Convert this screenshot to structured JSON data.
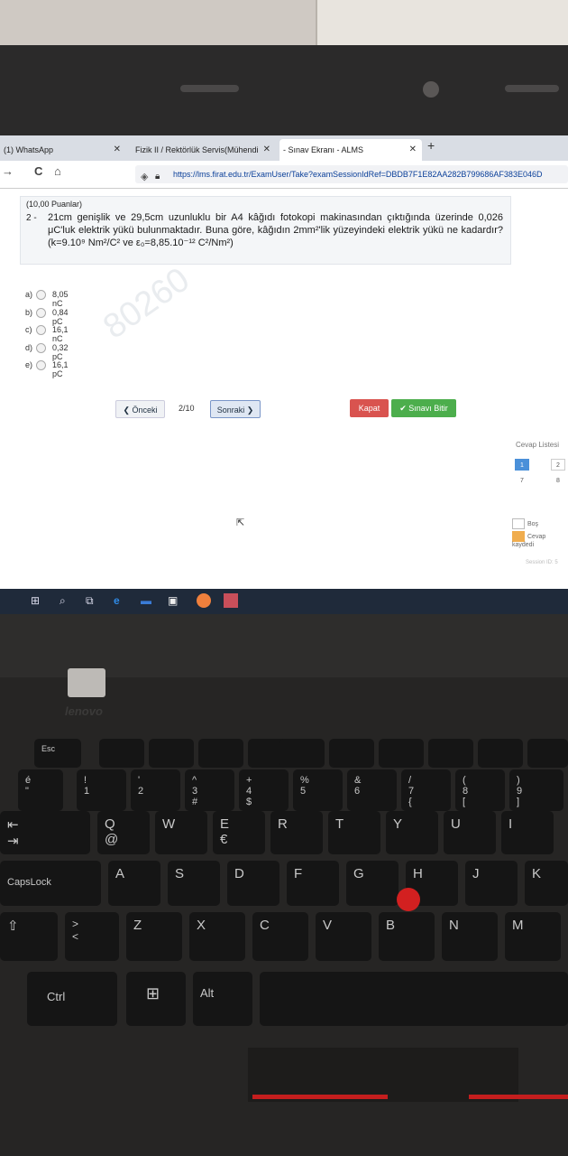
{
  "browser": {
    "tabs": [
      {
        "label": "(1) WhatsApp",
        "close": "✕"
      },
      {
        "label": "Fizik II / Rektörlük Servis(Mühendi",
        "close": "✕"
      },
      {
        "label": "- Sınav Ekranı - ALMS",
        "close": "✕"
      }
    ],
    "new_tab": "+",
    "back": "→",
    "reload": "C",
    "home": "⌂",
    "url": "https://lms.firat.edu.tr/ExamUser/Take?examSessionIdRef=DBDB7F1E82AA282B799686AF383E046D"
  },
  "question": {
    "points": "(10,00 Puanlar)",
    "number": "2 -",
    "text": "21cm genişlik ve 29,5cm uzunluklu bir A4 kâğıdı fotokopi makinasından çıktığında üzerinde 0,026 μC'luk elektrik yükü bulunmaktadır. Buna göre, kâğıdın 2mm²'lik yüzeyindeki elektrik yükü ne kadardır? (k=9.10⁹ Nm²/C² ve ε₀=8,85.10⁻¹² C²/Nm²)"
  },
  "answers": [
    {
      "label": "a)",
      "value": "8,05 nC"
    },
    {
      "label": "b)",
      "value": "0,84 pC"
    },
    {
      "label": "c)",
      "value": "16,1 nC"
    },
    {
      "label": "d)",
      "value": "0,32 pC"
    },
    {
      "label": "e)",
      "value": "16,1 pC"
    }
  ],
  "nav": {
    "prev": "❮ Önceki",
    "pager": "2/10",
    "next": "Sonraki ❯",
    "close": "Kapat",
    "finish": "✔ Sınavı Bitir"
  },
  "sidebar": {
    "title": "Cevap Listesi",
    "cells": [
      "1",
      "2",
      "7",
      "8"
    ],
    "legend_empty": "Boş",
    "legend_saved": "Cevap kaydedi",
    "session": "Session ID: 5"
  },
  "watermark": "80260",
  "laptop": {
    "brand": "lenovo",
    "keys": {
      "esc": "Esc",
      "caps": "CapsLock",
      "ctrl": "Ctrl",
      "alt": "Alt",
      "row_num": [
        "é\n\"",
        "!\n1",
        "'\n2",
        "^\n3\n#",
        "+\n4\n$",
        "%\n5",
        "&\n6",
        "/\n7\n{",
        "(\n8\n[",
        ")\n9\n]"
      ],
      "row_q": [
        "Q\n@",
        "W",
        "E\n€",
        "R",
        "T",
        "Y",
        "U",
        "I"
      ],
      "row_a": [
        "A",
        "S",
        "D",
        "F",
        "G",
        "H",
        "J",
        "K"
      ],
      "row_z": [
        ">\n<",
        "Z",
        "X",
        "C",
        "V",
        "B",
        "N",
        "M"
      ]
    }
  }
}
